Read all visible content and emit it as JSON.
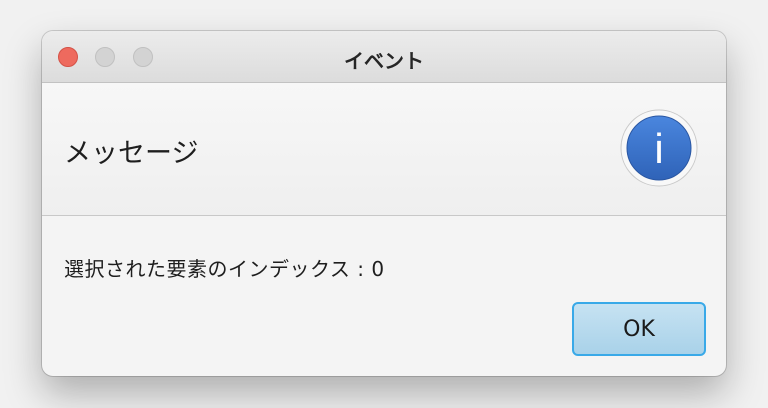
{
  "window": {
    "title": "イベント",
    "controls": [
      "close",
      "minimize",
      "maximize"
    ]
  },
  "header": {
    "text": "メッセージ",
    "icon": "info-icon",
    "icon_glyph": "i"
  },
  "content": {
    "message": "選択された要素のインデックス : 0"
  },
  "buttons": {
    "ok_label": "OK"
  },
  "colors": {
    "close": "#ee6a5e",
    "inactive_control": "#d3d3d3",
    "info_icon": "#3d73c9",
    "button_border": "#39a9e8",
    "button_fill": "#b8dbef"
  }
}
